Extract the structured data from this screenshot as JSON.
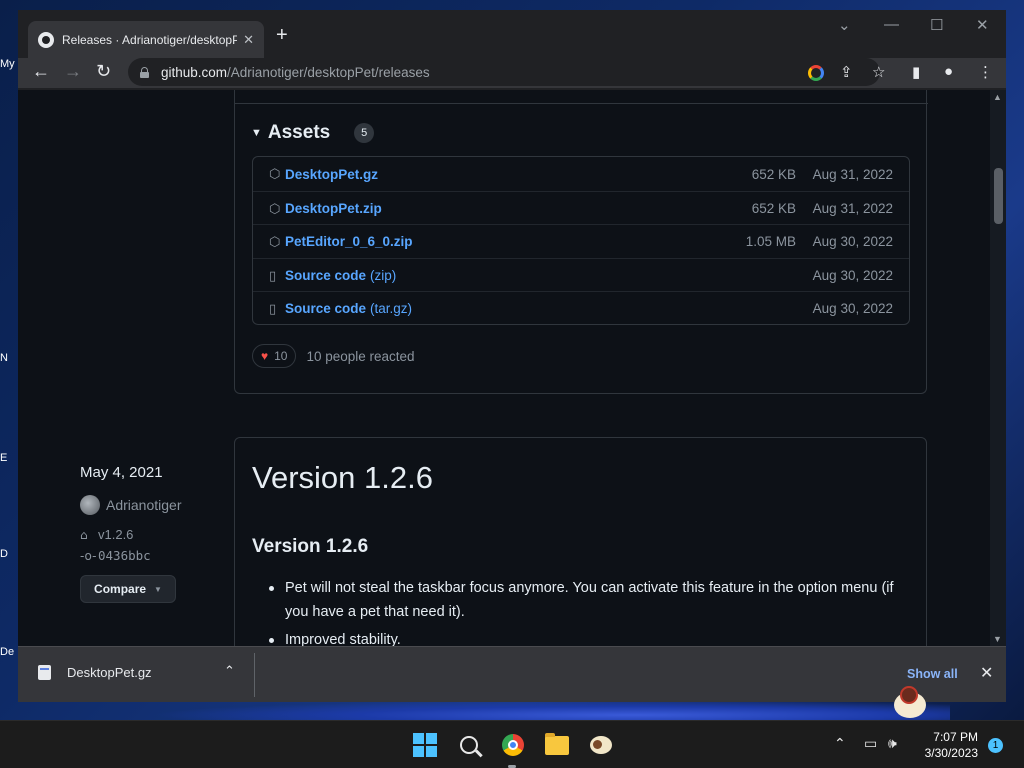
{
  "desktop": {
    "left_labels": [
      "My",
      "N",
      "E",
      "D",
      "De"
    ]
  },
  "browser": {
    "tab_title": "Releases · Adrianotiger/desktopP",
    "url_host": "github.com",
    "url_path": "/Adrianotiger/desktopPet/releases"
  },
  "assets": {
    "title": "Assets",
    "count": "5",
    "rows": [
      {
        "name": "DesktopPet.gz",
        "suffix": "",
        "size": "652 KB",
        "date": "Aug 31, 2022",
        "icon": "package-icon"
      },
      {
        "name": "DesktopPet.zip",
        "suffix": "",
        "size": "652 KB",
        "date": "Aug 31, 2022",
        "icon": "package-icon"
      },
      {
        "name": "PetEditor_0_6_0.zip",
        "suffix": "",
        "size": "1.05 MB",
        "date": "Aug 30, 2022",
        "icon": "package-icon"
      },
      {
        "name": "Source code",
        "suffix": "(zip)",
        "size": "",
        "date": "Aug 30, 2022",
        "icon": "file-zip-icon"
      },
      {
        "name": "Source code",
        "suffix": "(tar.gz)",
        "size": "",
        "date": "Aug 30, 2022",
        "icon": "file-zip-icon"
      }
    ]
  },
  "reactions": {
    "count": "10",
    "text": "10 people reacted"
  },
  "release": {
    "date": "May 4, 2021",
    "author": "Adrianotiger",
    "tag": "v1.2.6",
    "commit": "0436bbc",
    "compare_label": "Compare",
    "title": "Version 1.2.6",
    "subtitle": "Version 1.2.6",
    "bullets": [
      "Pet will not steal the taskbar focus anymore. You can activate this feature in the option menu (if you have a pet that need it).",
      "Improved stability."
    ]
  },
  "download_bar": {
    "file_name": "DesktopPet.gz",
    "show_all": "Show all"
  },
  "taskbar": {
    "time": "7:07 PM",
    "date": "3/30/2023",
    "notification_count": "1"
  },
  "colors": {
    "link": "#58a6ff",
    "page_bg": "#0d1117",
    "border": "#30363d"
  }
}
